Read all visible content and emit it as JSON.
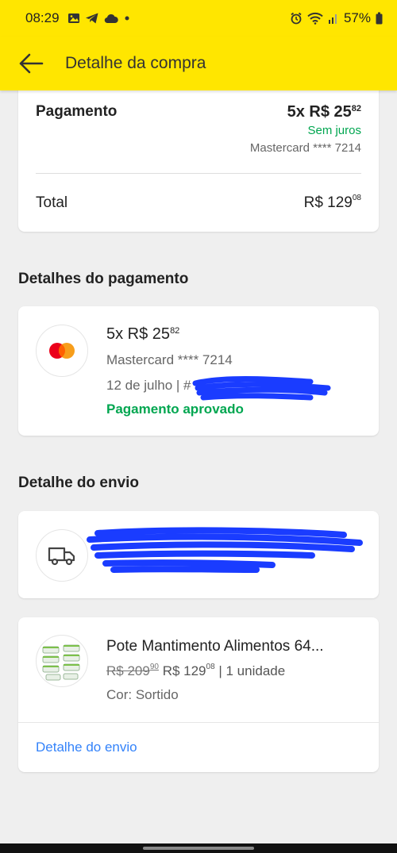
{
  "status_bar": {
    "time": "08:29",
    "battery": "57%"
  },
  "app_bar": {
    "title": "Detalhe da compra"
  },
  "payment_summary": {
    "label": "Pagamento",
    "amount_main": "5x R$ 25",
    "amount_cents": "82",
    "interest": "Sem juros",
    "card": "Mastercard **** 7214",
    "total_label": "Total",
    "total_main": "R$ 129",
    "total_cents": "08"
  },
  "payment_details": {
    "section_title": "Detalhes do pagamento",
    "amount_main": "5x R$ 25",
    "amount_cents": "82",
    "card": "Mastercard **** 7214",
    "date": "12 de julho  |  #",
    "status": "Pagamento aprovado"
  },
  "shipping": {
    "section_title": "Detalhe do envio"
  },
  "product": {
    "name": "Pote Mantimento Alimentos 64...",
    "old_price_main": "R$ 209",
    "old_price_cents": "90",
    "price_main": "R$ 129",
    "price_cents": "08",
    "quantity": " | 1 unidade",
    "color": "Cor: Sortido",
    "link": "Detalhe do envio"
  },
  "colors": {
    "brand_yellow": "#ffe600",
    "success_green": "#00a650",
    "link_blue": "#3483fa",
    "redaction_blue": "#1a3cff"
  }
}
